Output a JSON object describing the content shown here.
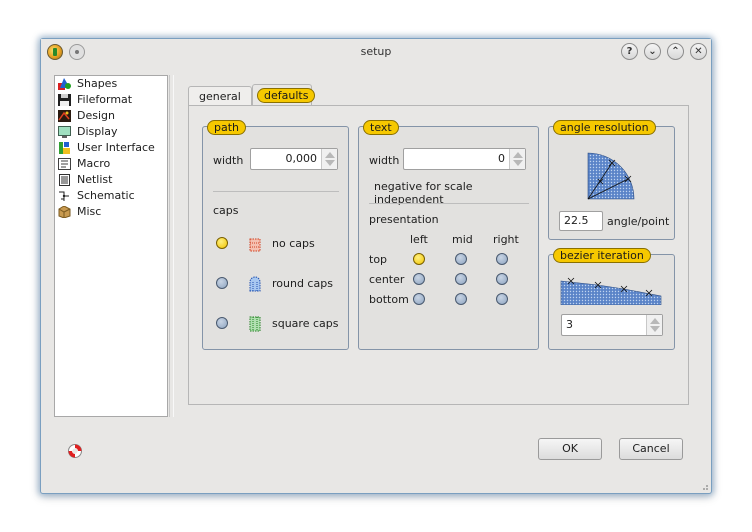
{
  "window": {
    "title": "setup"
  },
  "titlebar_buttons": [
    "?",
    "⌄",
    "⌃",
    "✕"
  ],
  "sidebar": {
    "items": [
      {
        "label": "Shapes",
        "icon": "shapes-icon"
      },
      {
        "label": "Fileformat",
        "icon": "floppy-icon"
      },
      {
        "label": "Design",
        "icon": "design-icon"
      },
      {
        "label": "Display",
        "icon": "monitor-icon"
      },
      {
        "label": "User Interface",
        "icon": "user-interface-icon"
      },
      {
        "label": "Macro",
        "icon": "macro-icon"
      },
      {
        "label": "Netlist",
        "icon": "netlist-icon"
      },
      {
        "label": "Schematic",
        "icon": "schematic-icon"
      },
      {
        "label": "Misc",
        "icon": "misc-box-icon"
      }
    ]
  },
  "tabs": {
    "general": "general",
    "defaults": "defaults",
    "active": "defaults"
  },
  "path_group": {
    "title": "path",
    "width_label": "width",
    "width_value": "0,000",
    "caps_label": "caps",
    "caps": [
      {
        "label": "no caps",
        "selected": true
      },
      {
        "label": "round caps",
        "selected": false
      },
      {
        "label": "square caps",
        "selected": false
      }
    ]
  },
  "text_group": {
    "title": "text",
    "width_label": "width",
    "width_value": "0",
    "note": "negative for scale independent",
    "presentation_label": "presentation",
    "columns": [
      "left",
      "mid",
      "right"
    ],
    "rows": [
      "top",
      "center",
      "bottom"
    ],
    "selected": {
      "row": "top",
      "column": "left"
    }
  },
  "angle_group": {
    "title": "angle resolution",
    "value": "22.5",
    "unit": "angle/point"
  },
  "bezier_group": {
    "title": "bezier iteration",
    "value": "3"
  },
  "buttons": {
    "ok": "OK",
    "cancel": "Cancel"
  },
  "colors": {
    "accent_pill": "#f6c800",
    "radio_on": "#f2c400",
    "radio_off": "#8ea4c0",
    "window_border": "#7a9fc0"
  }
}
